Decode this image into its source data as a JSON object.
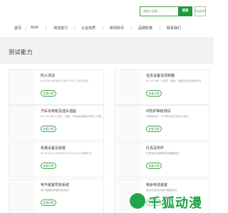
{
  "search": {
    "placeholder": "请输入检索...",
    "button_label": "搜索"
  },
  "language_button": "English",
  "nav": [
    "首页",
    "AUA",
    "测试能力",
    "认证资质",
    "新闻资讯",
    "品牌影像",
    "联系我们"
  ],
  "section": {
    "title": "测试能力"
  },
  "cards": [
    {
      "title": "防火测试",
      "desc": "AS1530.4标准/UL2625/ ISO 3 防火测试",
      "button": "查看详情"
    },
    {
      "title": "信息设备及控制器",
      "desc": "IEC 62368-1 信息、视频、音频及相关设备测试",
      "button": "查看详情"
    },
    {
      "title": "汽车充电枪及插头插座",
      "desc": "IEC 62196-1 插头、插座、车辆连接器及车辆入口测试",
      "button": "查看详情"
    },
    {
      "title": "IP防护等级测试",
      "desc": "IP等级测试，IP代码(防尘与防水)测试",
      "button": "查看详情"
    },
    {
      "title": "机械设备及装置",
      "desc": "AS 60204.1/UL/NZS 4024.1204 机械安全",
      "button": "查看详情"
    },
    {
      "title": "灯具及附件",
      "desc": "灯具测试及照明控制装置测试",
      "button": "查看详情"
    },
    {
      "title": "电气装置导管系统",
      "desc": "电气装置用导管系统测试",
      "button": "查看详情"
    },
    {
      "title": "剩余电流装置",
      "desc": "剩余电流动作保护装置测试",
      "button": "查看详情"
    }
  ],
  "watermark": "千狐动漫"
}
